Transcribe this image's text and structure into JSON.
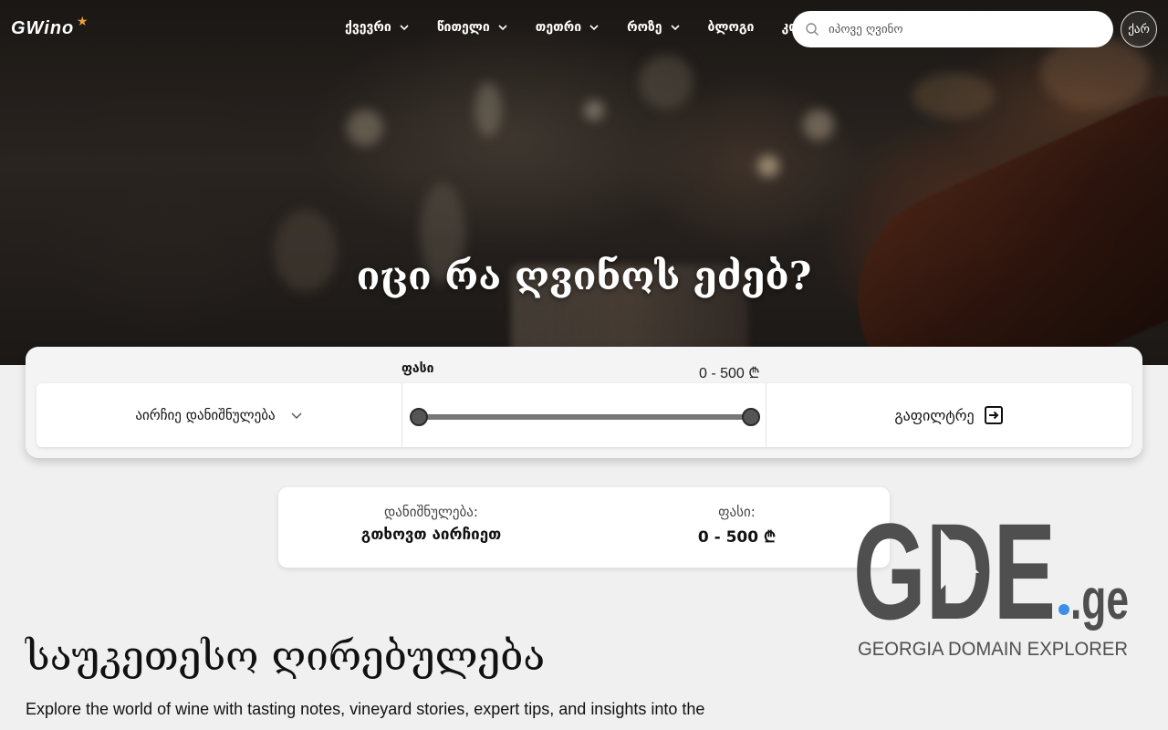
{
  "header": {
    "logo": "GWino",
    "logo_star": "★",
    "nav": [
      {
        "label": "ქვევრი",
        "dropdown": true
      },
      {
        "label": "წითელი",
        "dropdown": true
      },
      {
        "label": "თეთრი",
        "dropdown": true
      },
      {
        "label": "როზე",
        "dropdown": true
      },
      {
        "label": "ბლოგი",
        "dropdown": false
      },
      {
        "label": "კონტ",
        "dropdown": false
      }
    ],
    "search_placeholder": "იპოვე ღვინო",
    "avatar_alt": "ქარ"
  },
  "hero": {
    "title": "იცი რა ღვინოს ეძებ?"
  },
  "filter": {
    "price_title": "ფასი",
    "price_range": "0 - 500 ₾",
    "select_label": "აირჩიე დანიშნულება",
    "slider_min": 0,
    "slider_max": 500,
    "filter_button": "გაფილტრე"
  },
  "summary": {
    "purpose_label": "დანიშნულება:",
    "purpose_value": "გთხოვთ აირჩიეთ",
    "price_label": "ფასი:",
    "price_value": "0 - 500 ₾"
  },
  "watermark": {
    "brand": "GDE",
    "tld": ".ge",
    "tagline": "GEORGIA DOMAIN EXPLORER"
  },
  "section": {
    "title": "საუკეთესო ღირებულება",
    "text": "Explore the world of wine with tasting notes, vineyard stories, expert tips, and insights into the"
  },
  "colors": {
    "accent_star": "#e3a13a",
    "watermark_dot": "#3b8fe8",
    "watermark_gray": "#4f4f4f"
  }
}
